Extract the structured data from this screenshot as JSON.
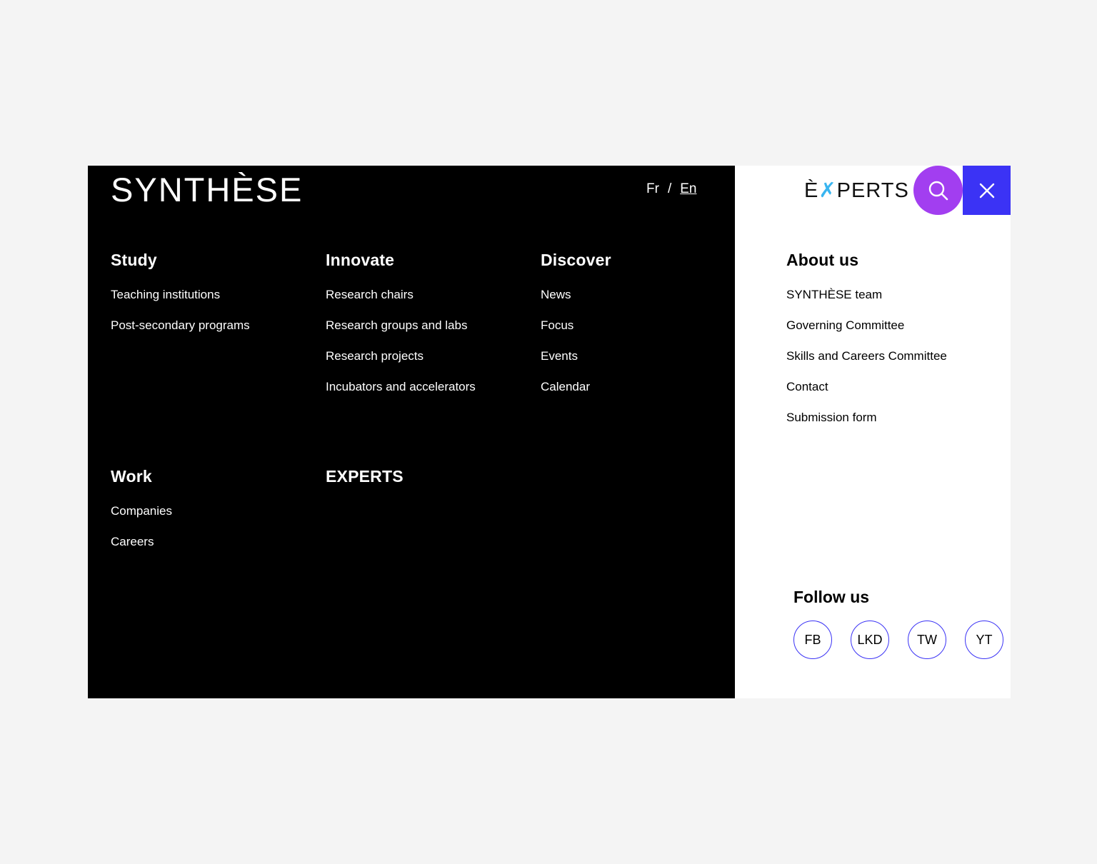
{
  "brand": {
    "logo": "SYNTHÈSE",
    "experts_logo_pre": "È",
    "experts_logo_accent": "✗",
    "experts_logo_post": "PERTS"
  },
  "lang": {
    "fr": "Fr",
    "sep": "/",
    "en": "En"
  },
  "menu": {
    "study": {
      "title": "Study",
      "items": [
        "Teaching institutions",
        "Post-secondary programs"
      ]
    },
    "innovate": {
      "title": "Innovate",
      "items": [
        "Research chairs",
        "Research groups and labs",
        "Research projects",
        "Incubators and accelerators"
      ]
    },
    "discover": {
      "title": "Discover",
      "items": [
        "News",
        "Focus",
        "Events",
        "Calendar"
      ]
    },
    "work": {
      "title": "Work",
      "items": [
        "Companies",
        "Careers"
      ]
    },
    "experts": {
      "title": "EXPERTS"
    },
    "about": {
      "title": "About us",
      "items": [
        "SYNTHÈSE team",
        "Governing Committee",
        "Skills and Careers Committee",
        "Contact",
        "Submission form"
      ]
    }
  },
  "follow": {
    "title": "Follow us",
    "items": [
      "FB",
      "LKD",
      "TW",
      "YT"
    ]
  },
  "colors": {
    "search_bg": "#a23ef0",
    "close_bg": "#3b33f5",
    "social_border": "#3b33f5",
    "experts_accent": "#39b5f0"
  },
  "icons": {
    "search": "search-icon",
    "close": "close-icon"
  }
}
